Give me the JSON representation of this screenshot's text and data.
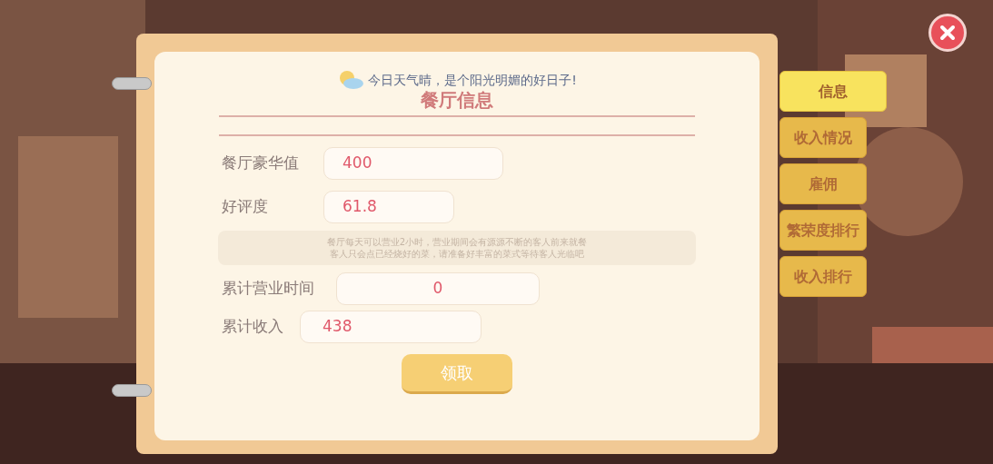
{
  "weather_banner": "今日天气晴，是个阳光明媚的好日子!",
  "title": "餐厅信息",
  "fields": [
    {
      "label": "餐厅豪华值",
      "value": "400"
    },
    {
      "label": "好评度",
      "value": "61.8"
    }
  ],
  "note": [
    "餐厅每天可以营业2小时，营业期间会有源源不断的客人前来就餐",
    "客人只会点已经烧好的菜，请准备好丰富的菜式等待客人光临吧"
  ],
  "stats": [
    {
      "label": "累计营业时间",
      "value": "0"
    },
    {
      "label": "累计收入",
      "value": "438"
    }
  ],
  "claim_button": "领取",
  "tabs": [
    {
      "label": "信息",
      "selected": true
    },
    {
      "label": "收入情况",
      "selected": false
    },
    {
      "label": "雇佣",
      "selected": false
    },
    {
      "label": "繁荣度排行",
      "selected": false
    },
    {
      "label": "收入排行",
      "selected": false
    }
  ]
}
